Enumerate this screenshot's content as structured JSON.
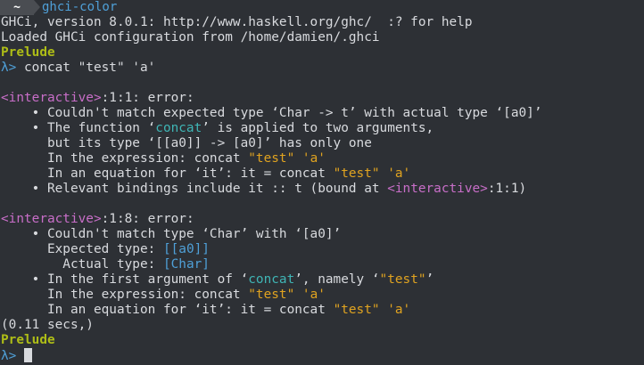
{
  "tab": {
    "home_label": "~",
    "title": "ghci-color"
  },
  "terminal": {
    "banner": "GHCi, version 8.0.1: http://www.haskell.org/ghc/  :? for help",
    "config_line": "Loaded GHCi configuration from /home/damien/.ghci",
    "module1": "Prelude",
    "prompt1": "λ>",
    "command1": " concat \"test\" 'a'",
    "err1": {
      "loc_tag": "<interactive>",
      "loc_rest": ":1:1: error:",
      "l1a": "    • Couldn't match expected type ‘Char -> t’ with actual type ‘[a0]’",
      "l2a": "    • The function ‘",
      "l2b": "concat",
      "l2c": "’ is applied to two arguments,",
      "l3": "      but its type ‘[[a0]] -> [a0]’ has only one",
      "l4a": "      In the expression: concat ",
      "l4b": "\"test\"",
      "l4c": " ",
      "l4d": "'a'",
      "l5a": "      In an equation for ‘it’: it = concat ",
      "l5b": "\"test\"",
      "l5c": " ",
      "l5d": "'a'",
      "l6a": "    • Relevant bindings include it :: t (bound at ",
      "l6b": "<interactive>",
      "l6c": ":1:1)"
    },
    "err2": {
      "loc_tag": "<interactive>",
      "loc_rest": ":1:8: error:",
      "l1": "    • Couldn't match type ‘Char’ with ‘[a0]’",
      "l2a": "      Expected type: ",
      "l2b": "[[a0]]",
      "l3a": "        Actual type: ",
      "l3b": "[Char]",
      "l4a": "    • In the first argument of ‘",
      "l4b": "concat",
      "l4c": "’, namely ‘",
      "l4d": "\"test\"",
      "l4e": "’",
      "l5a": "      In the expression: concat ",
      "l5b": "\"test\"",
      "l5c": " ",
      "l5d": "'a'",
      "l6a": "      In an equation for ‘it’: it = concat ",
      "l6b": "\"test\"",
      "l6c": " ",
      "l6d": "'a'"
    },
    "timing": "(0.11 secs,)",
    "module2": "Prelude",
    "prompt2": "λ>",
    "command2": " "
  }
}
